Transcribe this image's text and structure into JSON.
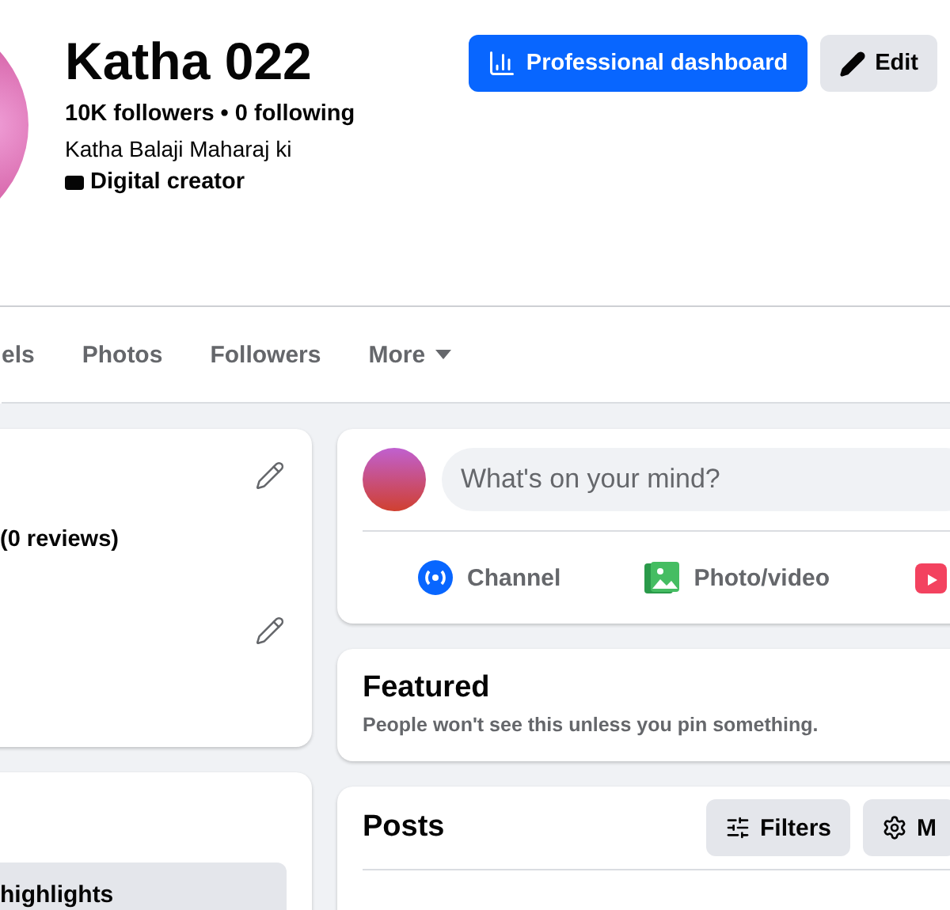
{
  "profile": {
    "name": "Katha 022",
    "stats": "10K followers • 0 following",
    "bio": "Katha Balaji Maharaj ki",
    "category": "Digital creator"
  },
  "actions": [
    {
      "label": "Professional dashboard",
      "kind": "primary"
    },
    {
      "label": "Edit",
      "kind": "secondary"
    }
  ],
  "tabs": [
    {
      "label": "els",
      "kind": "plain"
    },
    {
      "label": "Photos",
      "kind": "plain"
    },
    {
      "label": "Followers",
      "kind": "plain"
    },
    {
      "label": "More",
      "kind": "dropdown"
    }
  ],
  "intro": {
    "rating": "(0 reviews)"
  },
  "highlights": {
    "label": "highlights"
  },
  "composer": {
    "placeholder": "What's on your mind?",
    "actions": [
      {
        "label": "Channel",
        "kind": "channel"
      },
      {
        "label": "Photo/video",
        "kind": "photo"
      },
      {
        "kind": "reel"
      }
    ]
  },
  "featured": {
    "title": "Featured",
    "subtitle": "People won't see this unless you pin something."
  },
  "posts": {
    "title": "Posts",
    "buttons": [
      {
        "label": "Filters",
        "kind": "filters"
      },
      {
        "label": "M",
        "kind": "manage"
      }
    ]
  }
}
